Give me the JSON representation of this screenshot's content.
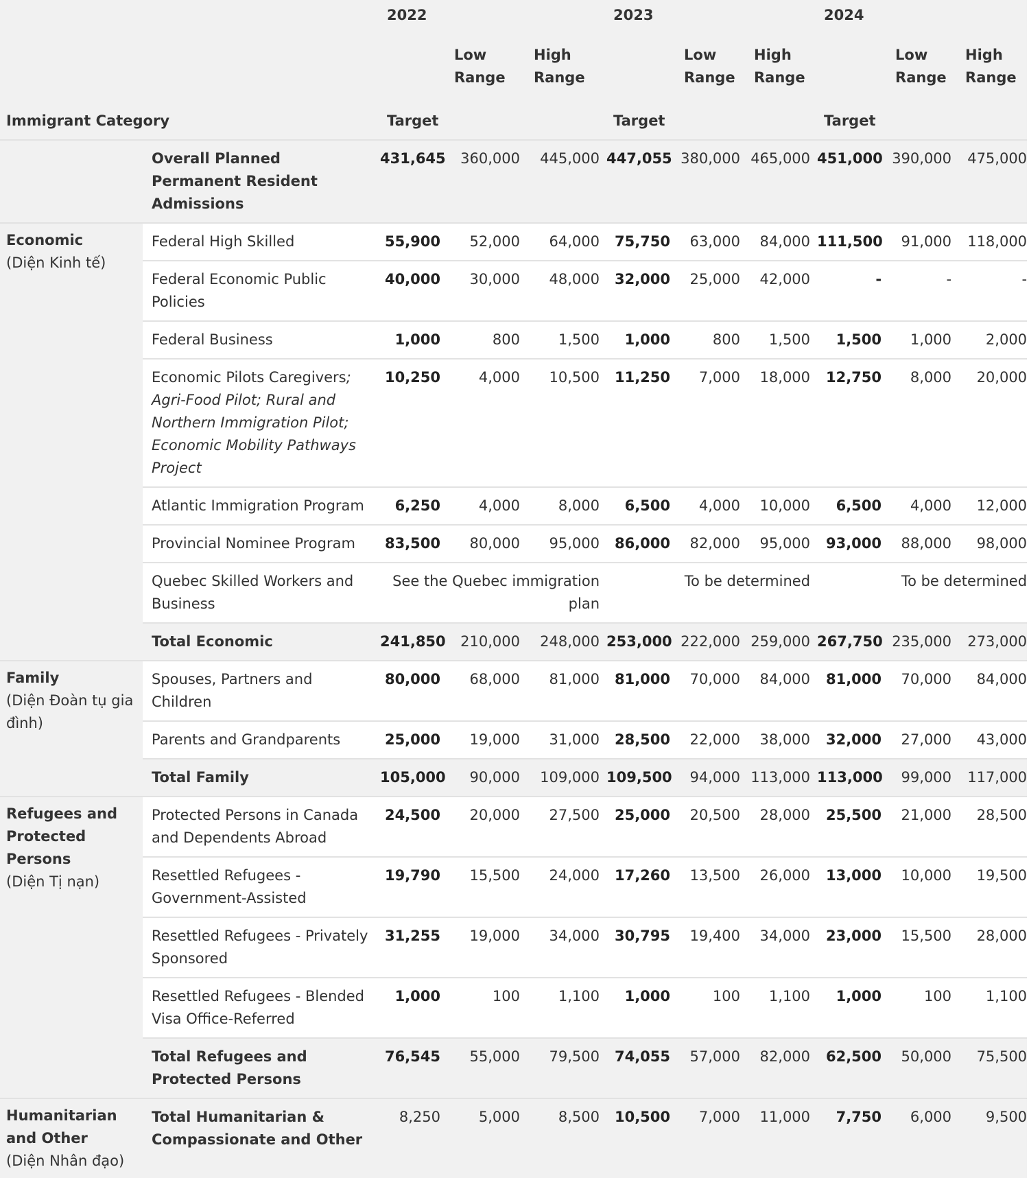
{
  "header": {
    "category_label": "Immigrant Category",
    "years": [
      "2022",
      "2023",
      "2024"
    ],
    "target_label": "Target",
    "low_label": "Low Range",
    "high_label": "High Range"
  },
  "overall": {
    "label": "Overall Planned Permanent Resident Admissions",
    "values": [
      "431,645",
      "360,000",
      "445,000",
      "447,055",
      "380,000",
      "465,000",
      "451,000",
      "390,000",
      "475,000"
    ]
  },
  "economic": {
    "category": "Economic",
    "category_vn": "(Diện Kinh tế)",
    "rows": [
      {
        "label": "Federal High Skilled",
        "values": [
          "55,900",
          "52,000",
          "64,000",
          "75,750",
          "63,000",
          "84,000",
          "111,500",
          "91,000",
          "118,000"
        ]
      },
      {
        "label": "Federal Economic Public Policies",
        "values": [
          "40,000",
          "30,000",
          "48,000",
          "32,000",
          "25,000",
          "42,000",
          "-",
          "-",
          "-"
        ]
      },
      {
        "label": "Federal Business",
        "values": [
          "1,000",
          "800",
          "1,500",
          "1,000",
          "800",
          "1,500",
          "1,500",
          "1,000",
          "2,000"
        ]
      },
      {
        "label": "Economic Pilots Caregivers",
        "label_italic": "; Agri-Food Pilot; Rural and Northern Immigration Pilot; Economic Mobility Pathways Project",
        "values": [
          "10,250",
          "4,000",
          "10,500",
          "11,250",
          "7,000",
          "18,000",
          "12,750",
          "8,000",
          "20,000"
        ]
      },
      {
        "label": "Atlantic Immigration Program",
        "values": [
          "6,250",
          "4,000",
          "8,000",
          "6,500",
          "4,000",
          "10,000",
          "6,500",
          "4,000",
          "12,000"
        ]
      },
      {
        "label": "Provincial Nominee Program",
        "values": [
          "83,500",
          "80,000",
          "95,000",
          "86,000",
          "82,000",
          "95,000",
          "93,000",
          "88,000",
          "98,000"
        ]
      }
    ],
    "quebec": {
      "label": "Quebec Skilled Workers and Business",
      "note_2022": "See the Quebec immigration plan",
      "note_2023": "To be determined",
      "note_2024": "To be determined"
    },
    "total": {
      "label": "Total Economic",
      "values": [
        "241,850",
        "210,000",
        "248,000",
        "253,000",
        "222,000",
        "259,000",
        "267,750",
        "235,000",
        "273,000"
      ]
    }
  },
  "family": {
    "category": "Family",
    "category_vn": "(Diện Đoàn tụ gia đình)",
    "rows": [
      {
        "label": "Spouses, Partners and Children",
        "values": [
          "80,000",
          "68,000",
          "81,000",
          "81,000",
          "70,000",
          "84,000",
          "81,000",
          "70,000",
          "84,000"
        ]
      },
      {
        "label": "Parents and Grandparents",
        "values": [
          "25,000",
          "19,000",
          "31,000",
          "28,500",
          "22,000",
          "38,000",
          "32,000",
          "27,000",
          "43,000"
        ]
      }
    ],
    "total": {
      "label": "Total Family",
      "values": [
        "105,000",
        "90,000",
        "109,000",
        "109,500",
        "94,000",
        "113,000",
        "113,000",
        "99,000",
        "117,000"
      ]
    }
  },
  "refugees": {
    "category": "Refugees and Protected Persons",
    "category_vn": "(Diện Tị nạn)",
    "rows": [
      {
        "label": "Protected Persons in Canada and Dependents Abroad",
        "values": [
          "24,500",
          "20,000",
          "27,500",
          "25,000",
          "20,500",
          "28,000",
          "25,500",
          "21,000",
          "28,500"
        ]
      },
      {
        "label": "Resettled Refugees - Government-Assisted",
        "values": [
          "19,790",
          "15,500",
          "24,000",
          "17,260",
          "13,500",
          "26,000",
          "13,000",
          "10,000",
          "19,500"
        ]
      },
      {
        "label": "Resettled Refugees - Privately Sponsored",
        "values": [
          "31,255",
          "19,000",
          "34,000",
          "30,795",
          "19,400",
          "34,000",
          "23,000",
          "15,500",
          "28,000"
        ]
      },
      {
        "label": "Resettled Refugees - Blended Visa Office-Referred",
        "values": [
          "1,000",
          "100",
          "1,100",
          "1,000",
          "100",
          "1,100",
          "1,000",
          "100",
          "1,100"
        ]
      }
    ],
    "total": {
      "label": "Total Refugees and Protected Persons",
      "values": [
        "76,545",
        "55,000",
        "79,500",
        "74,055",
        "57,000",
        "82,000",
        "62,500",
        "50,000",
        "75,500"
      ]
    }
  },
  "humanitarian": {
    "category": "Humanitarian and Other",
    "category_vn": "(Diện Nhân đạo)",
    "total": {
      "label": "Total Humanitarian & Compassionate and Other",
      "values": [
        "8,250",
        "5,000",
        "8,500",
        "10,500",
        "7,000",
        "11,000",
        "7,750",
        "6,000",
        "9,500"
      ]
    }
  }
}
